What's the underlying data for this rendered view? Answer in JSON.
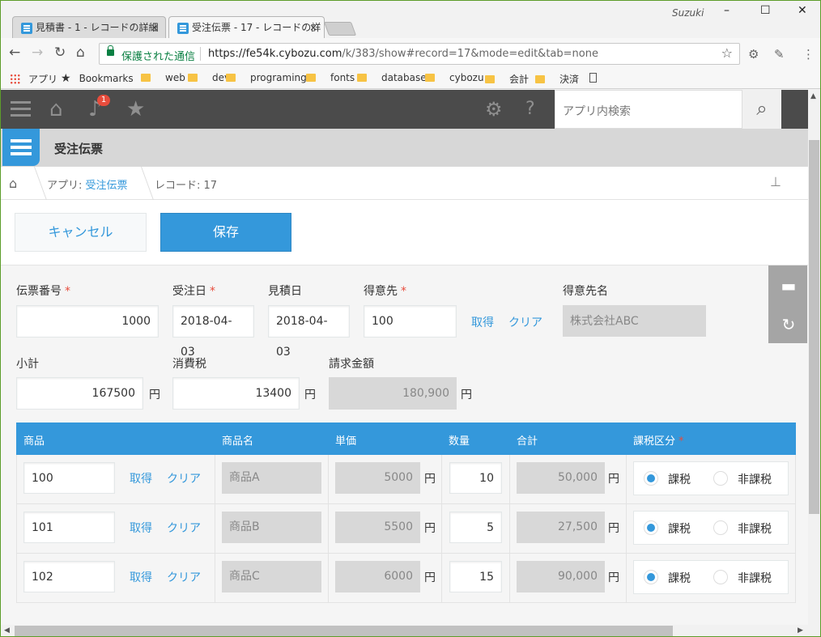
{
  "browser": {
    "tabs": [
      {
        "title": "見積書 - 1 - レコードの詳細",
        "close": "×"
      },
      {
        "title": "受注伝票 - 17 - レコードの詳",
        "close": "×"
      }
    ],
    "profile": "Suzuki",
    "window_controls": [
      "–",
      "☐",
      "✕"
    ],
    "secure_label": "保護された通信",
    "url_host": "https://fe54k.cybozu.com",
    "url_path": "/k/383/show#record=17&mode=edit&tab=none",
    "bookmarks": [
      "アプリ",
      "Bookmarks",
      "web",
      "dev",
      "programing",
      "fonts",
      "database",
      "cybozu",
      "会計",
      "決済"
    ]
  },
  "header": {
    "notification_count": "1",
    "search_placeholder": "アプリ内検索"
  },
  "app": {
    "name": "受注伝票"
  },
  "breadcrumb": {
    "app_prefix": "アプリ: ",
    "app_link": "受注伝票",
    "record": "レコード: 17"
  },
  "actions": {
    "cancel": "キャンセル",
    "save": "保存"
  },
  "form": {
    "slip_no_label": "伝票番号",
    "slip_no": "1000",
    "order_date_label": "受注日",
    "order_date": "2018-04-03",
    "estimate_date_label": "見積日",
    "estimate_date": "2018-04-03",
    "customer_label": "得意先",
    "customer": "100",
    "fetch": "取得",
    "clear": "クリア",
    "customer_name_label": "得意先名",
    "customer_name": "株式会社ABC",
    "subtotal_label": "小計",
    "subtotal": "167500",
    "tax_label": "消費税",
    "tax": "13400",
    "total_label": "請求金額",
    "total": "180,900",
    "yen": "円",
    "required_mark": "*"
  },
  "table": {
    "headers": {
      "product": "商品",
      "product_name": "商品名",
      "unit_price": "単価",
      "quantity": "数量",
      "sum": "合計",
      "tax_class": "課税区分"
    },
    "rows": [
      {
        "product": "100",
        "name": "商品A",
        "price": "5000",
        "qty": "10",
        "sum": "50,000",
        "taxable": "課税",
        "nontaxable": "非課税",
        "selected": "taxable"
      },
      {
        "product": "101",
        "name": "商品B",
        "price": "5500",
        "qty": "5",
        "sum": "27,500",
        "taxable": "課税",
        "nontaxable": "非課税",
        "selected": "taxable"
      },
      {
        "product": "102",
        "name": "商品C",
        "price": "6000",
        "qty": "15",
        "sum": "90,000",
        "taxable": "課税",
        "nontaxable": "非課税",
        "selected": "taxable"
      }
    ]
  },
  "colors": {
    "accent": "#3498db",
    "header_bg": "#4b4b4b",
    "required": "#e74c3c"
  }
}
